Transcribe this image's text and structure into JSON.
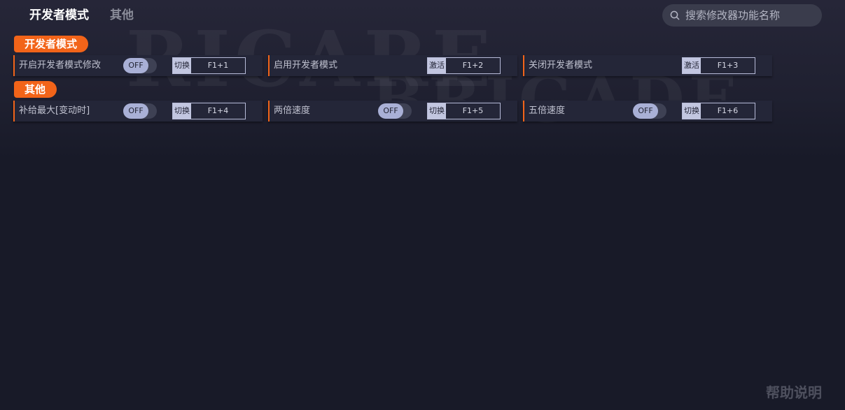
{
  "tabs": [
    {
      "label": "开发者模式",
      "active": true
    },
    {
      "label": "其他",
      "active": false
    }
  ],
  "search": {
    "placeholder": "搜索修改器功能名称",
    "icon": "search-icon"
  },
  "sections": [
    {
      "title": "开发者模式",
      "items": [
        {
          "name": "开启开发者模式修改",
          "toggle": "OFF",
          "action": "切换",
          "hotkey": "F1+1"
        },
        {
          "name": "启用开发者模式",
          "action": "激活",
          "hotkey": "F1+2"
        },
        {
          "name": "关闭开发者模式",
          "action": "激活",
          "hotkey": "F1+3"
        }
      ]
    },
    {
      "title": "其他",
      "items": [
        {
          "name": "补给最大[变动时]",
          "toggle": "OFF",
          "action": "切换",
          "hotkey": "F1+4"
        },
        {
          "name": "两倍速度",
          "toggle": "OFF",
          "action": "切换",
          "hotkey": "F1+5"
        },
        {
          "name": "五倍速度",
          "toggle": "OFF",
          "action": "切换",
          "hotkey": "F1+6"
        }
      ]
    }
  ],
  "help_label": "帮助说明",
  "colors": {
    "accent": "#f26419",
    "background": "#181a28",
    "card": "#242638"
  }
}
